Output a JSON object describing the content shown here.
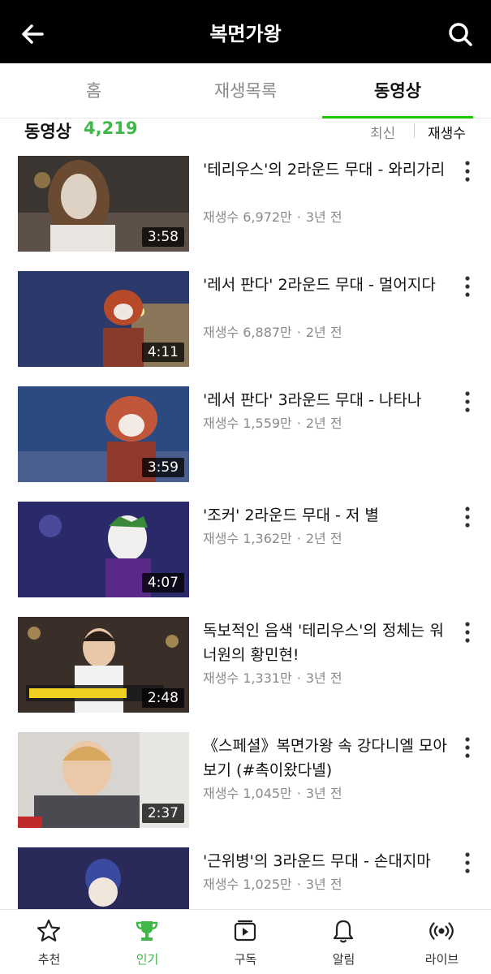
{
  "header": {
    "title": "복면가왕"
  },
  "tabs": [
    {
      "label": "홈"
    },
    {
      "label": "재생목록"
    },
    {
      "label": "동영상",
      "selected": true
    }
  ],
  "list": {
    "title": "동영상",
    "count": "4,219",
    "sort_latest": "최신",
    "sort_views": "재생수"
  },
  "videos": [
    {
      "title": "'테리우스'의 2라운드 무대 - 와리가리",
      "views": "재생수 6,972만",
      "age": "3년 전",
      "duration": "3:58"
    },
    {
      "title": "'레서 판다' 2라운드 무대 - 멀어지다",
      "views": "재생수 6,887만",
      "age": "2년 전",
      "duration": "4:11"
    },
    {
      "title": "'레서 판다' 3라운드 무대 - 나타나",
      "views": "재생수 1,559만",
      "age": "2년 전",
      "duration": "3:59"
    },
    {
      "title": "'조커' 2라운드 무대 - 저 별",
      "views": "재생수 1,362만",
      "age": "2년 전",
      "duration": "4:07"
    },
    {
      "title": "독보적인 음색 '테리우스'의 정체는 워너원의 황민현!",
      "views": "재생수 1,331만",
      "age": "3년 전",
      "duration": "2:48"
    },
    {
      "title": "《스페셜》복면가왕 속 강다니엘 모아보기 (#촉이왔다녤)",
      "views": "재생수 1,045만",
      "age": "3년 전",
      "duration": "2:37"
    },
    {
      "title": "'근위병'의 3라운드 무대 - 손대지마",
      "views": "재생수 1,025만",
      "age": "3년 전",
      "duration": ""
    }
  ],
  "bottom_nav": [
    {
      "label": "추천",
      "icon": "star-icon"
    },
    {
      "label": "인기",
      "icon": "trophy-icon",
      "active": true
    },
    {
      "label": "구독",
      "icon": "subscription-icon"
    },
    {
      "label": "알림",
      "icon": "bell-icon"
    },
    {
      "label": "라이브",
      "icon": "live-icon"
    }
  ],
  "colors": {
    "accent": "#3fb849",
    "topbar": "#000000",
    "tab_indicator": "#1ec800"
  }
}
